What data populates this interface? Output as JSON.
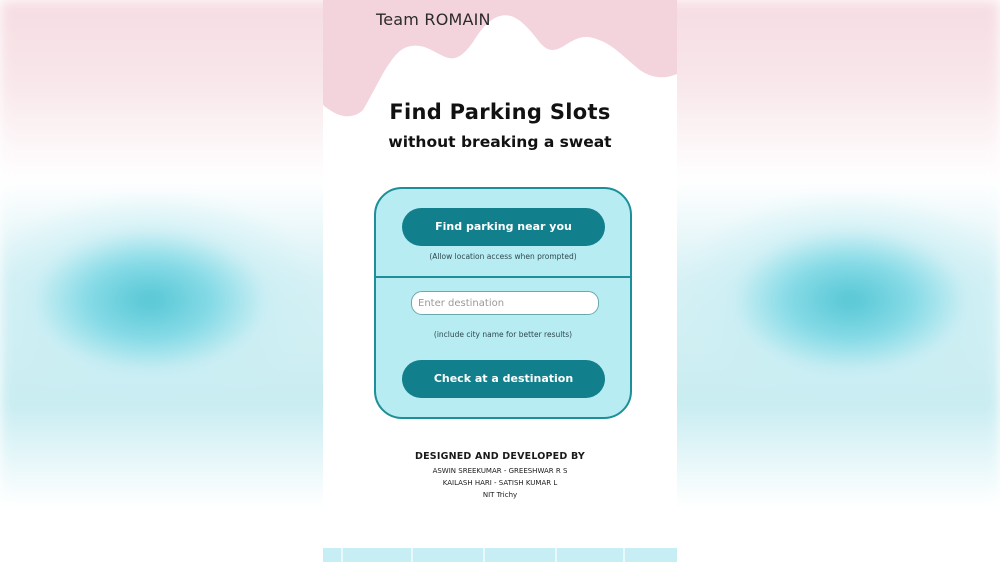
{
  "header": {
    "team_name": "Team ROMAIN"
  },
  "hero": {
    "title": "Find Parking Slots",
    "subtitle": "without breaking a sweat"
  },
  "card": {
    "find_button_label": "Find parking near you",
    "location_hint": "(Allow location access when prompted)",
    "destination_input": {
      "value": "",
      "placeholder": "Enter destination"
    },
    "city_hint": "(include city name for better results)",
    "check_button_label": "Check at a destination"
  },
  "credits": {
    "heading": "DESIGNED AND DEVELOPED BY",
    "lines": [
      "ASWIN SREEKUMAR - GREESHWAR R S",
      "KAILASH HARI - SATISH KUMAR L",
      "NIT Trichy"
    ]
  },
  "colors": {
    "accent": "#12808c",
    "card_fill": "#b8ecf3",
    "card_border": "#1e8f99",
    "top_pink": "#f3d4dc"
  }
}
